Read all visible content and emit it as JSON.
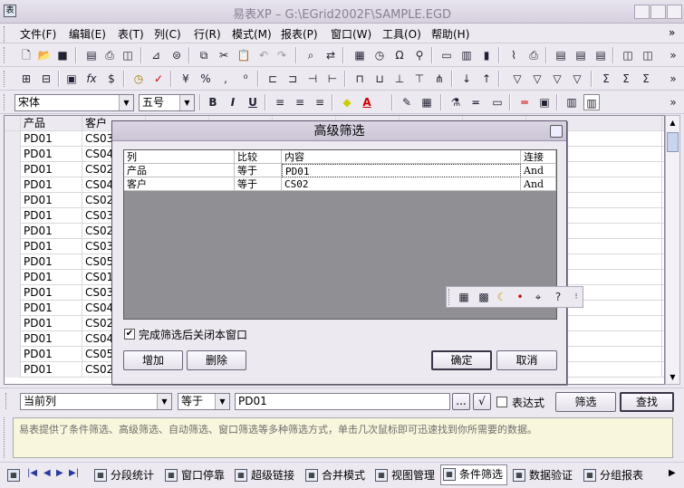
{
  "window": {
    "title": "易表XP  –  G:\\EGrid2002F\\SAMPLE.EGD",
    "controls": [
      "_",
      "□",
      "×"
    ]
  },
  "menu": [
    "文件(F)",
    "编辑(E)",
    "表(T)",
    "列(C)",
    "行(R)",
    "模式(M)",
    "报表(P)",
    "窗口(W)",
    "工具(O)",
    "帮助(H)"
  ],
  "format_toolbar": {
    "font": "宋体",
    "size": "五号",
    "bold": "B",
    "italic": "I",
    "underline": "U"
  },
  "grid": {
    "headers": [
      "产品",
      "客户",
      "",
      "",
      "",
      "",
      "",
      "",
      ""
    ],
    "rows": [
      [
        "PD01",
        "CS03"
      ],
      [
        "PD01",
        "CS04"
      ],
      [
        "PD01",
        "CS02"
      ],
      [
        "PD01",
        "CS04"
      ],
      [
        "PD01",
        "CS02"
      ],
      [
        "PD01",
        "CS03"
      ],
      [
        "PD01",
        "CS02"
      ],
      [
        "PD01",
        "CS03"
      ],
      [
        "PD01",
        "CS05"
      ],
      [
        "PD01",
        "CS01"
      ],
      [
        "PD01",
        "CS03"
      ],
      [
        "PD01",
        "CS04"
      ],
      [
        "PD01",
        "CS02"
      ],
      [
        "PD01",
        "CS04"
      ],
      [
        "PD01",
        "CS05"
      ],
      [
        "PD01",
        "CS02"
      ]
    ]
  },
  "dialog": {
    "title": "高级筛选",
    "columns": [
      "列",
      "比较",
      "内容",
      "连接"
    ],
    "filters": [
      {
        "column": "产品",
        "compare": "等于",
        "content": "PD01",
        "join": "And"
      },
      {
        "column": "客户",
        "compare": "等于",
        "content": "CS02",
        "join": "And"
      }
    ],
    "close_after_label": "完成筛选后关闭本窗口",
    "close_after_checked": true,
    "add_label": "增加",
    "delete_label": "删除",
    "ok_label": "确定",
    "cancel_label": "取消"
  },
  "filterbar": {
    "column_value": "当前列",
    "compare_value": "等于",
    "content_value": "PD01",
    "ellipsis_label": "...",
    "check_label": "√",
    "expression_label": "表达式",
    "filter_label": "筛选",
    "find_label": "查找"
  },
  "info_text": "易表提供了条件筛选、高级筛选、自动筛选、窗口筛选等多种筛选方式，单击几次鼠标即可迅速找到你所需要的数据。",
  "status_tabs": [
    "分段统计",
    "窗口停靠",
    "超级链接",
    "合并模式",
    "视图管理",
    "条件筛选",
    "数据验证",
    "分组报表"
  ],
  "active_tab": "条件筛选"
}
